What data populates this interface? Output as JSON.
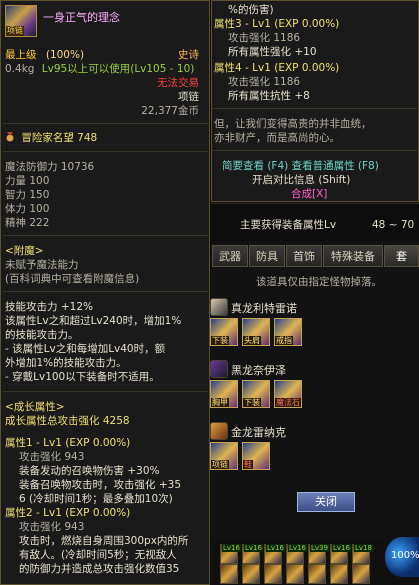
{
  "item": {
    "name": "一身正气的理念",
    "icon_tag": "项链",
    "level": "最上级",
    "level_pct": "(100%)",
    "rarity": "史诗",
    "weight": "0.4kg",
    "req": "Lv95以上可以使用(Lv105 - 10)",
    "untradeable": "无法交易",
    "type": "项链",
    "price": "22,377金币",
    "fame": "冒险家名望 748",
    "mdef": "魔法防御力 10736",
    "str": "力量 100",
    "int": "智力 150",
    "vit": "体力 100",
    "spr": "精神 222",
    "enchant_title": "<附魔>",
    "enchant_none": "未赋予魔法能力",
    "enchant_hint": "(百科词典中可查看附魔信息)",
    "skill_lines": [
      "技能攻击力 +12%",
      "该属性Lv之和超过Lv240时，增加1%",
      "的技能攻击力。",
      "- 该属性Lv之和每增加Lv40时，额",
      "外增加1%的技能攻击力。",
      "- 穿戴Lv100以下装备时不适用。"
    ],
    "growth_title": "<成长属性>",
    "growth_total": "成长属性总攻击强化 4258",
    "attr1_title": "属性1 - Lv1 (EXP 0.00%)",
    "attr1_atk": "攻击强化 943",
    "attr1_lines": [
      "装备发动的召唤物伤害 +30%",
      "装备召唤物攻击时，攻击强化 +35",
      "6 (冷却时间1秒；最多叠加10次)"
    ],
    "attr2_title": "属性2 - Lv1 (EXP 0.00%)",
    "attr2_atk": "攻击强化 943",
    "attr2_lines": [
      "攻击时，燃烧自身周围300px内的所",
      "有敌人。(冷却时间5秒；无视敌人",
      "的防御力并造成总攻击强化数值35"
    ]
  },
  "right": {
    "top_line": "%的伤害)",
    "attr3_title": "属性3 - Lv1 (EXP 0.00%)",
    "attr3_atk": "攻击强化 1186",
    "attr3_bonus": "所有属性强化 +10",
    "attr4_title": "属性4 - Lv1 (EXP 0.00%)",
    "attr4_atk": "攻击强化 1186",
    "attr4_bonus": "所有属性抗性 +8",
    "flavor_1": "但，让我们变得高贵的并非血统，",
    "flavor_2": "亦非财产，而是高尚的心。",
    "simple_view": "简要查看 (F4) 查看普通属性 (F8)",
    "compare": "开启对比信息 (Shift)",
    "compose": "合成[X]",
    "main_attr": "主要获得装备属性Lv",
    "main_range": "48 ~ 70",
    "tabs": [
      "武器",
      "防具",
      "首饰",
      "特殊装备",
      "套"
    ],
    "drop_hint": "该道具仅由指定怪物掉落。",
    "monsters": [
      {
        "name": "真龙利特雷诺",
        "slots": [
          "下装",
          "头肩",
          "戒指"
        ]
      },
      {
        "name": "黑龙奈伊泽",
        "slots": [
          "胸甲",
          "下装",
          "魔法石"
        ]
      },
      {
        "name": "金龙雷纳克",
        "slots": [
          "项链",
          "鞋"
        ]
      }
    ],
    "close_label": "关闭",
    "orb_text": "100%",
    "hotkeys": [
      "Lv16",
      "Lv16",
      "Lv16",
      "Lv16",
      "Lv39",
      "Lv16",
      "Lv18"
    ]
  }
}
